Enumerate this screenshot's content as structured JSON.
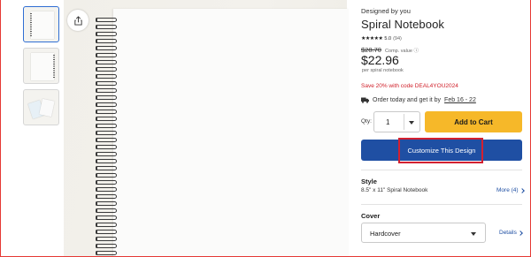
{
  "gallery": {
    "thumbnails": [
      "notebook-front",
      "notebook-angle",
      "notebook-open"
    ]
  },
  "product": {
    "designer_label": "Designed by you",
    "title": "Spiral Notebook",
    "rating_stars": "★★★★★",
    "rating_value": "5.0",
    "rating_count": "(94)",
    "old_price": "$28.70",
    "comp_label": "Comp. value ⓘ",
    "price": "$22.96",
    "price_unit": "per spiral notebook",
    "promo": "Save 20% with code DEAL4YOU2024",
    "delivery_text": "Order today and get it by",
    "delivery_date": "Feb 16 - 22"
  },
  "purchase": {
    "qty_label": "Qty:",
    "qty_value": "1",
    "add_to_cart": "Add to Cart",
    "customize": "Customize This Design"
  },
  "style": {
    "label": "Style",
    "value": "8.5\" x 11\" Spiral Notebook",
    "more": "More (4)"
  },
  "cover": {
    "label": "Cover",
    "value": "Hardcover",
    "details": "Details"
  },
  "colors": {
    "accent_blue": "#1f4fa3",
    "cart_yellow": "#f6b829",
    "promo_red": "#d0202a"
  }
}
